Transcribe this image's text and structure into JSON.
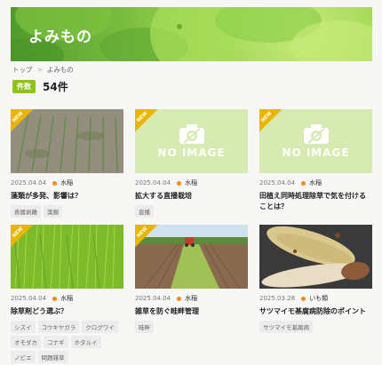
{
  "hero": {
    "title": "よみもの"
  },
  "breadcrumb": {
    "home": "トップ",
    "sep": ">",
    "current": "よみもの"
  },
  "count": {
    "label": "件数",
    "value": "54件"
  },
  "new_label": "NEW",
  "no_image_label": "NO IMAGE",
  "colors": {
    "accent": "#8dc21f",
    "category_dot": "#f08a1c",
    "new_badge": "#e8b600",
    "no_image_bg": "#d6eab1"
  },
  "cards": [
    {
      "date": "2025.04.04",
      "category": "水稲",
      "title": "藻類が多発、影響は？",
      "tags": [
        "表層剥離",
        "藻類"
      ],
      "image": "photo"
    },
    {
      "date": "2025.04.04",
      "category": "水稲",
      "title": "拡大する直播栽培",
      "tags": [
        "直播"
      ],
      "image": "none"
    },
    {
      "date": "2025.04.04",
      "category": "水稲",
      "title": "田植え同時処理除草で気を付けることは？",
      "tags": [],
      "image": "none"
    },
    {
      "date": "2025.04.04",
      "category": "水稲",
      "title": "除草剤どう選ぶ？",
      "tags": [
        "シズイ",
        "コウキヤガラ",
        "クログワイ",
        "オモダカ",
        "コナギ",
        "ホタルイ",
        "ノビエ",
        "問題雑草"
      ],
      "image": "photo"
    },
    {
      "date": "2025.04.04",
      "category": "水稲",
      "title": "雑草を防ぐ畦畔管理",
      "tags": [
        "畦畔"
      ],
      "image": "photo"
    },
    {
      "date": "2025.03.28",
      "category": "いも類",
      "title": "サツマイモ基腐病防除のポイント",
      "tags": [
        "サツマイモ基腐病"
      ],
      "image": "photo"
    }
  ]
}
